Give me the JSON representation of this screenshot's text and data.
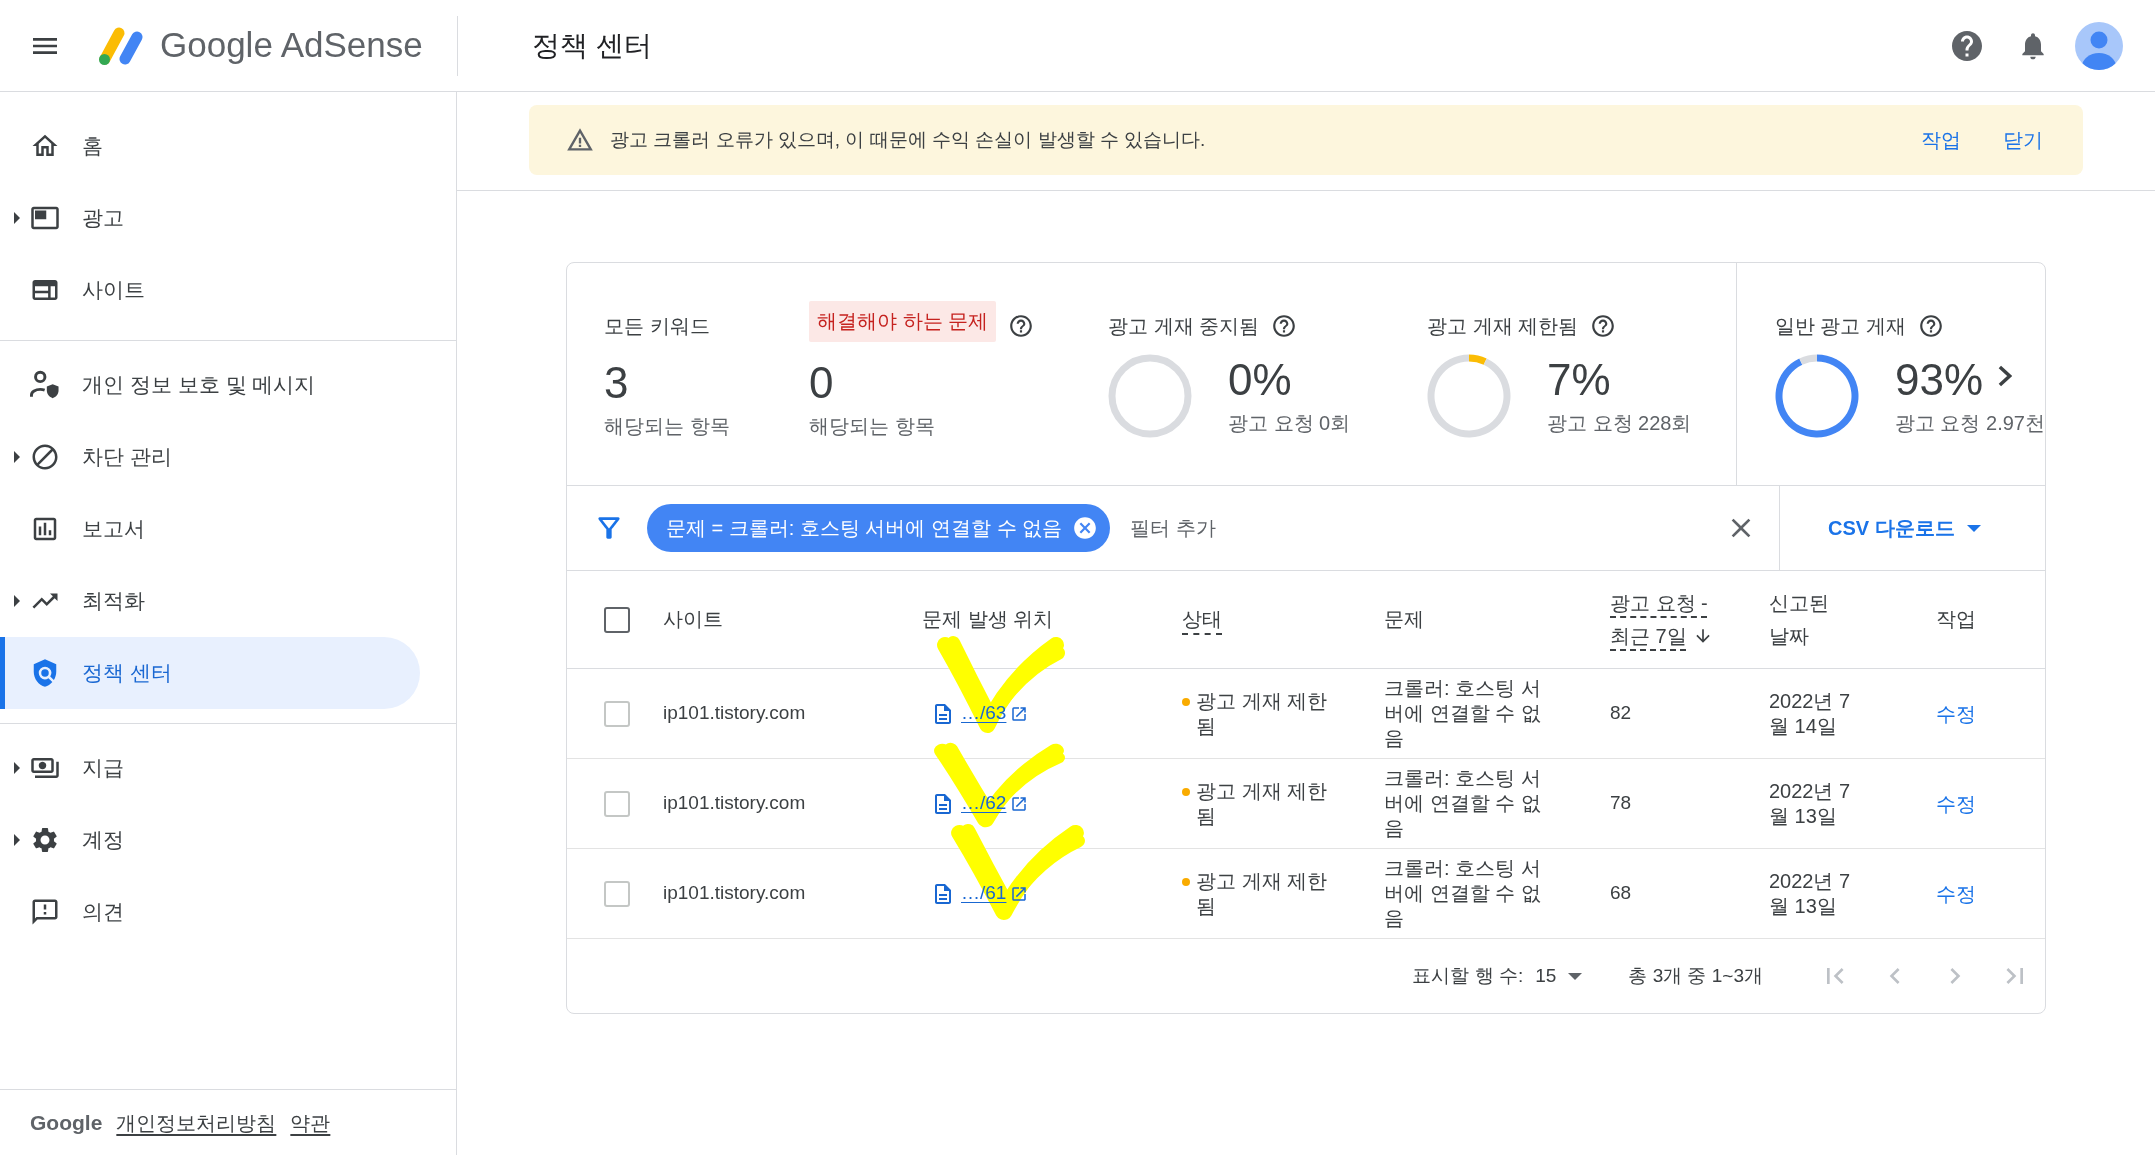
{
  "header": {
    "brand": "Google AdSense",
    "page_title": "정책 센터"
  },
  "sidebar": {
    "sections": [
      {
        "items": [
          {
            "label": "홈",
            "expandable": false,
            "selected": false
          },
          {
            "label": "광고",
            "expandable": true,
            "selected": false
          },
          {
            "label": "사이트",
            "expandable": false,
            "selected": false
          }
        ]
      },
      {
        "items": [
          {
            "label": "개인 정보 보호 및 메시지",
            "expandable": false,
            "selected": false
          },
          {
            "label": "차단 관리",
            "expandable": true,
            "selected": false
          },
          {
            "label": "보고서",
            "expandable": false,
            "selected": false
          },
          {
            "label": "최적화",
            "expandable": true,
            "selected": false
          },
          {
            "label": "정책 센터",
            "expandable": false,
            "selected": true
          }
        ]
      },
      {
        "items": [
          {
            "label": "지급",
            "expandable": true,
            "selected": false
          },
          {
            "label": "계정",
            "expandable": true,
            "selected": false
          },
          {
            "label": "의견",
            "expandable": false,
            "selected": false
          }
        ]
      }
    ],
    "footer": {
      "brand": "Google",
      "links": [
        "개인정보처리방침",
        "약관"
      ]
    }
  },
  "banner": {
    "message": "광고 크롤러 오류가 있으며, 이 때문에 수익 손실이 발생할 수 있습니다.",
    "actions": [
      "작업",
      "닫기"
    ]
  },
  "stats": [
    {
      "kind": "count",
      "label": "모든 키워드",
      "highlighted": false,
      "help": false,
      "value": "3",
      "caption": "해당되는 항목"
    },
    {
      "kind": "count",
      "label": "해결해야 하는 문제",
      "highlighted": true,
      "help": true,
      "value": "0",
      "caption": "해당되는 항목"
    },
    {
      "kind": "donut",
      "label": "광고 게재 중지됨",
      "highlighted": false,
      "help": true,
      "value": "0%",
      "caption": "광고 요청 0회"
    },
    {
      "kind": "donut",
      "label": "광고 게재 제한됨",
      "highlighted": false,
      "help": true,
      "color": "#fbbc04",
      "chart_data": {
        "type": "donut",
        "values": [
          7,
          93
        ]
      },
      "value": "7%",
      "caption": "광고 요청 228회"
    },
    {
      "kind": "donut",
      "label": "일반 광고 게재",
      "highlighted": false,
      "help": true,
      "color": "#4285f4",
      "chart_data": {
        "type": "donut",
        "values": [
          93,
          7
        ]
      },
      "value": "93%",
      "caption": "광고 요청 2.97천"
    }
  ],
  "filter": {
    "chips": [
      "문제 = 크롤러: 호스팅 서버에 연결할 수 없음"
    ],
    "placeholder": "필터 추가",
    "download": "CSV 다운로드"
  },
  "table": {
    "all_checked": false,
    "columns": [
      {
        "label": "사이트",
        "underlined": false,
        "sorted": false
      },
      {
        "label": "문제 발생 위치",
        "underlined": false,
        "sorted": false
      },
      {
        "label": "상태",
        "underlined": true,
        "sorted": false
      },
      {
        "label": "문제",
        "underlined": false,
        "sorted": false
      },
      {
        "label": "광고 요청 - 최근 7일",
        "underlined": true,
        "sorted": true
      },
      {
        "label": "신고된 날짜",
        "underlined": false,
        "sorted": false
      },
      {
        "label": "작업",
        "underlined": false,
        "sorted": false
      }
    ],
    "rows": [
      {
        "checked": false,
        "site": "ip101.tistory.com",
        "location": "…/63",
        "status": "광고 게재 제한됨",
        "color": "#f9ab00",
        "problem": "크롤러: 호스팅 서버에 연결할 수 없음",
        "requests": "82",
        "reported": "2022년 7월 14일",
        "action": "수정"
      },
      {
        "checked": false,
        "site": "ip101.tistory.com",
        "location": "…/62",
        "status": "광고 게재 제한됨",
        "color": "#f9ab00",
        "problem": "크롤러: 호스팅 서버에 연결할 수 없음",
        "requests": "78",
        "reported": "2022년 7월 13일",
        "action": "수정"
      },
      {
        "checked": false,
        "site": "ip101.tistory.com",
        "location": "…/61",
        "status": "광고 게재 제한됨",
        "color": "#f9ab00",
        "problem": "크롤러: 호스팅 서버에 연결할 수 없음",
        "requests": "68",
        "reported": "2022년 7월 13일",
        "action": "수정"
      }
    ]
  },
  "pagination": {
    "rows_label": "표시할 행 수:",
    "rows_value": "15",
    "range": "총 3개 중 1~3개",
    "buttons": [
      {
        "disabled": true
      },
      {
        "disabled": true
      },
      {
        "disabled": true
      },
      {
        "disabled": true
      }
    ]
  }
}
